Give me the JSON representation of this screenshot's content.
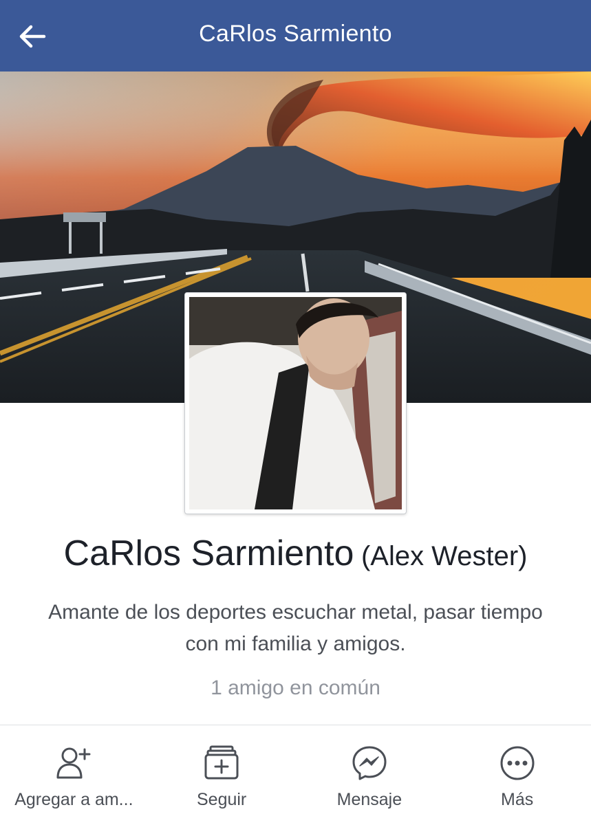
{
  "header": {
    "title": "CaRlos Sarmiento",
    "back_icon": "arrow-left-icon",
    "background_color": "#3b5998"
  },
  "cover": {
    "description_icon": "cover-photo-volcano-road"
  },
  "profile": {
    "name": "CaRlos Sarmiento",
    "alternate_name": "(Alex Wester)",
    "bio": "Amante de los deportes escuchar metal, pasar tiempo con mi familia y amigos.",
    "mutual_friends": "1 amigo en común"
  },
  "actions": [
    {
      "label": "Agregar a am...",
      "icon": "add-friend-icon"
    },
    {
      "label": "Seguir",
      "icon": "follow-icon"
    },
    {
      "label": "Mensaje",
      "icon": "messenger-icon"
    },
    {
      "label": "Más",
      "icon": "more-icon"
    }
  ],
  "colors": {
    "brand": "#3b5998",
    "text_primary": "#1d2129",
    "text_secondary": "#4b4f56",
    "text_muted": "#90949c"
  }
}
